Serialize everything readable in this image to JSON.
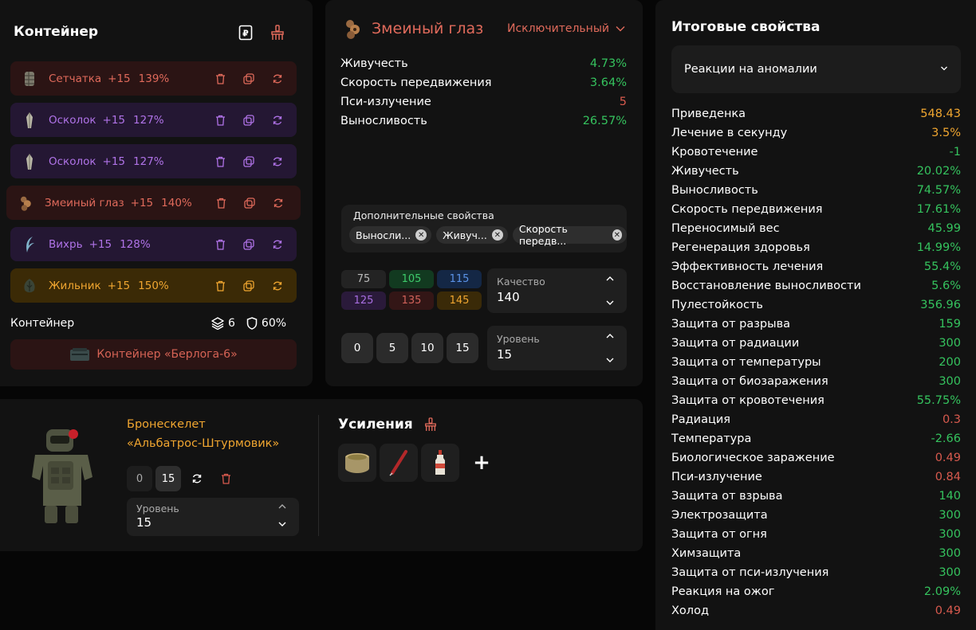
{
  "container_panel": {
    "title": "Контейнер",
    "artifacts": [
      {
        "name": "Сетчатка",
        "level": "+15",
        "percent": "139%",
        "rarity": "red",
        "icon": "mesh-artifact-icon"
      },
      {
        "name": "Осколок",
        "level": "+15",
        "percent": "127%",
        "rarity": "purple",
        "icon": "shard-artifact-icon"
      },
      {
        "name": "Осколок",
        "level": "+15",
        "percent": "127%",
        "rarity": "purple",
        "icon": "shard-artifact-icon"
      },
      {
        "name": "Змеиный глаз",
        "level": "+15",
        "percent": "140%",
        "rarity": "red",
        "icon": "snake-eye-artifact-icon"
      },
      {
        "name": "Вихрь",
        "level": "+15",
        "percent": "128%",
        "rarity": "purple",
        "icon": "whirl-artifact-icon"
      },
      {
        "name": "Жильник",
        "level": "+15",
        "percent": "150%",
        "rarity": "orange",
        "icon": "vein-artifact-icon"
      }
    ],
    "container_label": "Контейнер",
    "slots": "6",
    "protection": "60%",
    "container_button": "Контейнер «Берлога-6»"
  },
  "artifact_panel": {
    "name": "Змеиный глаз",
    "quality": "Исключительный",
    "properties": [
      {
        "name": "Живучесть",
        "value": "4.73%",
        "color": "green"
      },
      {
        "name": "Скорость передвижения",
        "value": "3.64%",
        "color": "green"
      },
      {
        "name": "Пси-излучение",
        "value": "5",
        "color": "red"
      },
      {
        "name": "Выносливость",
        "value": "26.57%",
        "color": "green"
      }
    ],
    "extra_title": "Дополнительные свойства",
    "extra_chips": [
      "Выносли...",
      "Живуч...",
      "Скорость передв..."
    ],
    "quality_presets": [
      "75",
      "105",
      "115",
      "125",
      "135",
      "145"
    ],
    "quality_label": "Качество",
    "quality_value": "140",
    "level_presets": [
      "0",
      "5",
      "10",
      "15"
    ],
    "level_label": "Уровень",
    "level_value": "15"
  },
  "armor_panel": {
    "name_line1": "Бронескелет",
    "name_line2": "«Альбатрос-Штурмовик»",
    "level_off": "0",
    "level_on": "15",
    "level_label": "Уровень",
    "level_value": "15",
    "boost_title": "Усиления",
    "boosts": [
      "pot-icon",
      "syringe-icon",
      "bottle-icon"
    ],
    "add_label": "+"
  },
  "totals_panel": {
    "title": "Итоговые свойства",
    "filter": "Реакции на аномалии",
    "items": [
      {
        "name": "Приведенка",
        "value": "548.43",
        "color": "orange"
      },
      {
        "name": "Лечение в секунду",
        "value": "3.5%",
        "color": "orange"
      },
      {
        "name": "Кровотечение",
        "value": "-1",
        "color": "green"
      },
      {
        "name": "Живучесть",
        "value": "20.02%",
        "color": "green"
      },
      {
        "name": "Выносливость",
        "value": "74.57%",
        "color": "green"
      },
      {
        "name": "Скорость передвижения",
        "value": "17.61%",
        "color": "green"
      },
      {
        "name": "Переносимый вес",
        "value": "45.99",
        "color": "green"
      },
      {
        "name": "Регенерация здоровья",
        "value": "14.99%",
        "color": "green"
      },
      {
        "name": "Эффективность лечения",
        "value": "55.4%",
        "color": "green"
      },
      {
        "name": "Восстановление выносливости",
        "value": "5.6%",
        "color": "green"
      },
      {
        "name": "Пулестойкость",
        "value": "356.96",
        "color": "green"
      },
      {
        "name": "Защита от разрыва",
        "value": "159",
        "color": "green"
      },
      {
        "name": "Защита от радиации",
        "value": "300",
        "color": "green"
      },
      {
        "name": "Защита от температуры",
        "value": "200",
        "color": "green"
      },
      {
        "name": "Защита от биозаражения",
        "value": "300",
        "color": "green"
      },
      {
        "name": "Защита от кровотечения",
        "value": "55.75%",
        "color": "green"
      },
      {
        "name": "Радиация",
        "value": "0.3",
        "color": "red"
      },
      {
        "name": "Температура",
        "value": "-2.66",
        "color": "green"
      },
      {
        "name": "Биологическое заражение",
        "value": "0.49",
        "color": "red"
      },
      {
        "name": "Пси-излучение",
        "value": "0.84",
        "color": "red"
      },
      {
        "name": "Защита от взрыва",
        "value": "140",
        "color": "green"
      },
      {
        "name": "Электрозащита",
        "value": "300",
        "color": "green"
      },
      {
        "name": "Защита от огня",
        "value": "300",
        "color": "green"
      },
      {
        "name": "Химзащита",
        "value": "300",
        "color": "green"
      },
      {
        "name": "Защита от пси-излучения",
        "value": "300",
        "color": "green"
      },
      {
        "name": "Реакция на ожог",
        "value": "2.09%",
        "color": "green"
      },
      {
        "name": "Холод",
        "value": "0.49",
        "color": "red"
      }
    ]
  },
  "colors": {
    "green": "#35c35e",
    "red": "#d85a4e",
    "orange": "#f0a630",
    "purple": "#b073e8",
    "panel": "#121212"
  }
}
